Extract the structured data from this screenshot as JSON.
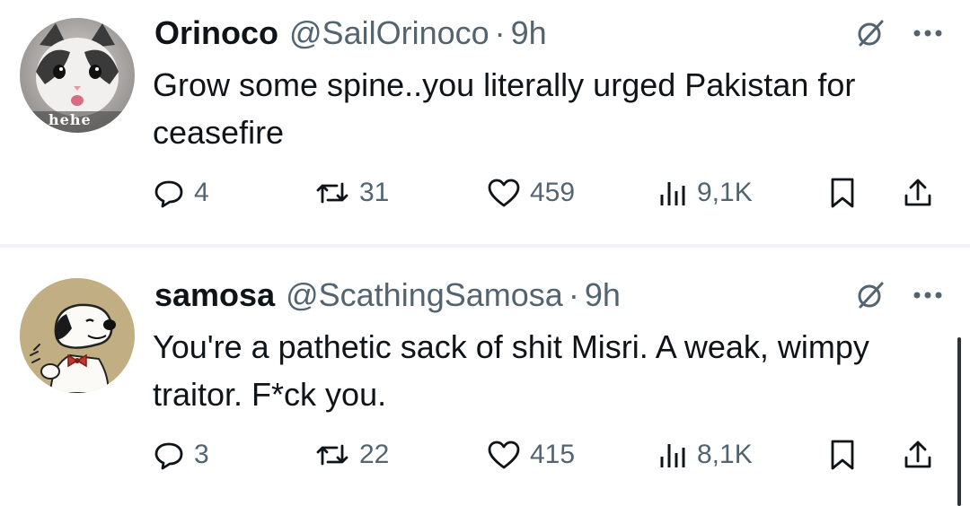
{
  "tweets": [
    {
      "name": "Orinoco",
      "handle": "@SailOrinoco",
      "separator": "·",
      "time": "9h",
      "text": "Grow some spine..you literally urged Pakistan for ceasefire",
      "avatar_caption": "hehe",
      "avatar_description": "white-and-grey kitten",
      "replies": "4",
      "reposts": "31",
      "likes": "459",
      "views": "9,1K"
    },
    {
      "name": "samosa",
      "handle": "@ScathingSamosa",
      "separator": "·",
      "time": "9h",
      "text": "You're a pathetic sack of shit Misri. A weak, wimpy traitor. F*ck you.",
      "avatar_description": "Snoopy cartoon dog",
      "replies": "3",
      "reposts": "22",
      "likes": "415",
      "views": "8,1K"
    }
  ],
  "icons": [
    "grok-icon",
    "more-icon",
    "reply-icon",
    "repost-icon",
    "like-icon",
    "views-icon",
    "bookmark-icon",
    "share-icon"
  ],
  "colors": {
    "text_primary": "#0f1419",
    "text_secondary": "#536471",
    "divider": "#eff3f4",
    "background": "#ffffff"
  }
}
